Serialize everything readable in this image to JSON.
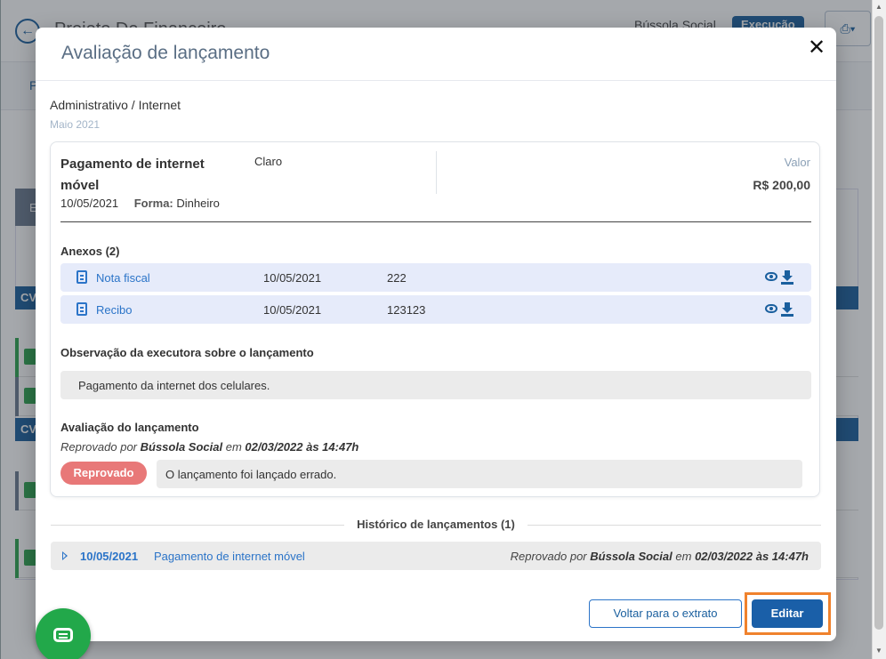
{
  "background": {
    "back_icon": "back-arrow-icon",
    "title": "Projeto De Financeiro",
    "org": "Bússola Social",
    "status": "Execução",
    "print_icon": "printer-icon",
    "subnav_initial": "P",
    "panel_initial": "E",
    "cv_label": "CV"
  },
  "modal": {
    "title": "Avaliação de lançamento",
    "close_icon": "close-icon",
    "breadcrumb": "Administrativo / Internet",
    "month": "Maio 2021",
    "entry": {
      "description": "Pagamento de internet móvel",
      "vendor": "Claro",
      "date": "10/05/2021",
      "form_label": "Forma:",
      "form_value": "Dinheiro",
      "value_label": "Valor",
      "value": "R$ 200,00"
    },
    "attachments_title": "Anexos (2)",
    "attachments": [
      {
        "name": "Nota fiscal",
        "date": "10/05/2021",
        "number": "222"
      },
      {
        "name": "Recibo",
        "date": "10/05/2021",
        "number": "123123"
      }
    ],
    "observation_title": "Observação da executora sobre o lançamento",
    "observation": "Pagamento da internet dos celulares.",
    "evaluation_title": "Avaliação do lançamento",
    "evaluation": {
      "prefix": "Reprovado por",
      "by": "Bússola Social",
      "mid": "em",
      "when": "02/03/2022 às 14:47h",
      "status": "Reprovado",
      "comment": "O lançamento foi lançado errado."
    },
    "history_title": "Histórico de lançamentos (1)",
    "history": [
      {
        "date": "10/05/2021",
        "description": "Pagamento de internet móvel",
        "prefix": "Reprovado por",
        "by": "Bússola Social",
        "mid": "em",
        "when": "02/03/2022 às 14:47h"
      }
    ],
    "buttons": {
      "back": "Voltar para o extrato",
      "edit": "Editar"
    }
  },
  "chat_icon": "chat-icon",
  "colors": {
    "primary": "#1a5fa8",
    "link": "#2b74c8",
    "rejected": "#e87878",
    "highlight": "#f0822d",
    "chat": "#22a84a"
  }
}
